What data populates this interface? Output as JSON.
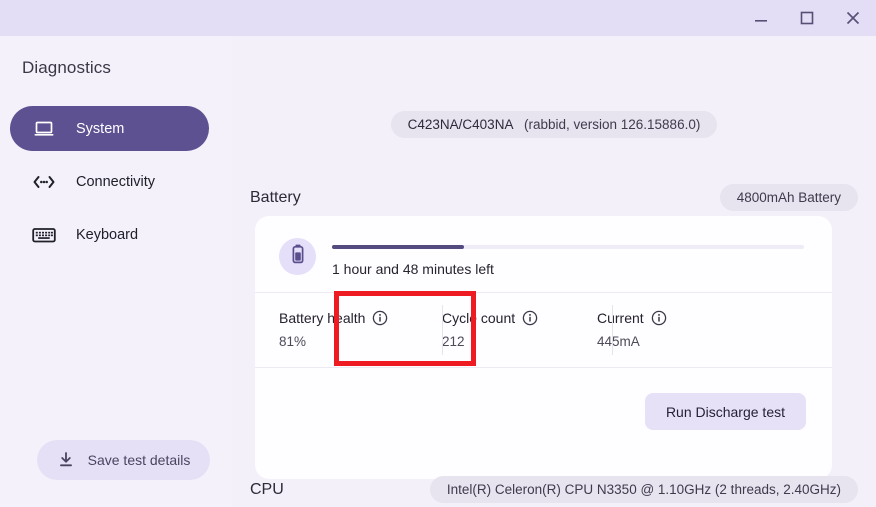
{
  "window": {
    "controls": [
      {
        "name": "minimize",
        "glyph": "minimize-icon"
      },
      {
        "name": "maximize",
        "glyph": "maximize-icon"
      },
      {
        "name": "close",
        "glyph": "close-icon"
      }
    ]
  },
  "sidebar": {
    "app_title": "Diagnostics",
    "items": [
      {
        "label": "System",
        "icon": "laptop-icon",
        "active": true
      },
      {
        "label": "Connectivity",
        "icon": "connectivity-icon",
        "active": false
      },
      {
        "label": "Keyboard",
        "icon": "keyboard-icon",
        "active": false
      }
    ],
    "save_button": {
      "label": "Save test details",
      "icon": "download-icon"
    }
  },
  "main": {
    "device_chip": {
      "model": "C423NA/C403NA",
      "details": "(rabbid, version 126.15886.0)"
    },
    "battery": {
      "section_title": "Battery",
      "chip": "4800mAh Battery",
      "icon": "battery-icon",
      "charge_percent": 28,
      "time_remaining": "1 hour and 48 minutes left",
      "stats": [
        {
          "label": "Battery health",
          "value": "81%",
          "icon": "info-icon"
        },
        {
          "label": "Cycle count",
          "value": "212",
          "icon": "info-icon"
        },
        {
          "label": "Current",
          "value": "445mA",
          "icon": "info-icon"
        }
      ],
      "run_button": "Run Discharge test"
    },
    "cpu": {
      "section_title": "CPU",
      "chip": "Intel(R) Celeron(R) CPU N3350 @ 1.10GHz (2 threads, 2.40GHz)"
    }
  },
  "annotation": {
    "highlight_color": "#ee1c22",
    "target": "battery-health-stat"
  },
  "colors": {
    "accent": "#5d5191",
    "titlebar": "#e3ddf5",
    "page_bg": "#f3f0fa",
    "sidebar_bg": "#f5f1fb",
    "card_bg": "#fefdff"
  }
}
